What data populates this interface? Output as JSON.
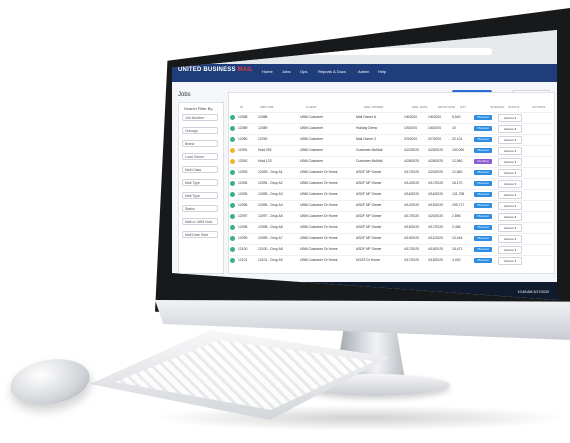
{
  "screen": {
    "brand": {
      "white": "UNITED BUSINESS",
      "red": "MAIL"
    },
    "nav": [
      "Home",
      "Jobs",
      "Ops",
      "Reports & Docs",
      "Admin",
      "Help"
    ],
    "page_title": "Jobs",
    "buttons": {
      "schedule": "+ Schedule Job",
      "export": "Export Data"
    },
    "filters": {
      "title": "Search Filter By",
      "fields": [
        "Job Number",
        "Chicago",
        "Brand",
        "Load Owner",
        "Mail Class",
        "Mail Type",
        "Mail Type",
        "Status",
        "Mail or UBM Now",
        "Mail Date Start"
      ]
    },
    "table_headers": [
      "ID",
      "UBM JOB",
      "CLIENT",
      "MAIL OWNER",
      "MAIL DATE",
      "DROP DATE",
      "QTY",
      "INTERVAL",
      "STATUS",
      "ACTIONS"
    ],
    "rows": [
      {
        "id": "12088",
        "job": "12088",
        "client": "UBM Customer",
        "owner": "Mail Owner A",
        "mail": "1/6/2020",
        "drop": "1/6/2020",
        "qty": "5,540",
        "status": "Planned",
        "color": "#2d8de3"
      },
      {
        "id": "12089",
        "job": "12089",
        "client": "UBM Customer",
        "owner": "Holiday Demo",
        "mail": "1/5/2020",
        "drop": "1/8/2020",
        "qty": "10",
        "status": "Planned",
        "color": "#2d8de3"
      },
      {
        "id": "12090",
        "job": "12290",
        "client": "UBM Customer",
        "owner": "Mail Owner 2",
        "mail": "2/3/2020",
        "drop": "3/7/2020",
        "qty": "22,101",
        "status": "Planned",
        "color": "#2d8de3"
      },
      {
        "id": "12091",
        "job": "Hold 092",
        "client": "UBM Customer",
        "owner": "Customer McMail",
        "mail": "4/22/2020",
        "drop": "4/25/2020",
        "qty": "100,000",
        "status": "Planned",
        "color": "#2d8de3"
      },
      {
        "id": "12092",
        "job": "Hold 123",
        "client": "UBM Customer",
        "owner": "Customer McMail",
        "mail": "4/28/2020",
        "drop": "4/28/2020",
        "qty": "12,560",
        "status": "Pending",
        "color": "#8e5bd6"
      },
      {
        "id": "12093",
        "job": "12093 - Drop A1",
        "client": "UBM Customer Dr Home",
        "owner": "ASDF NP Owner",
        "mail": "4/17/2020",
        "drop": "4/20/2020",
        "qty": "12,840",
        "status": "Planned",
        "color": "#2d8de3"
      },
      {
        "id": "12094",
        "job": "12094 - Drop A2",
        "client": "UBM Customer Dr Home",
        "owner": "ASDF NP Owner",
        "mail": "4/14/2020",
        "drop": "4/17/2020",
        "qty": "18,170",
        "status": "Planned",
        "color": "#2d8de3"
      },
      {
        "id": "12095",
        "job": "12095 - Drop A3",
        "client": "UBM Customer Dr Home",
        "owner": "ASDF NP Owner",
        "mail": "4/16/2020",
        "drop": "4/16/2020",
        "qty": "131,758",
        "status": "Planned",
        "color": "#2d8de3"
      },
      {
        "id": "12096",
        "job": "12096 - Drop A4",
        "client": "UBM Customer Dr Home",
        "owner": "ASDF NP Owner",
        "mail": "4/14/2020",
        "drop": "4/15/2020",
        "qty": "199,717",
        "status": "Planned",
        "color": "#2d8de3"
      },
      {
        "id": "12097",
        "job": "12097 - Drop A5",
        "client": "UBM Customer Dr Home",
        "owner": "ASDF NP Owner",
        "mail": "4/17/2020",
        "drop": "4/20/2020",
        "qty": "2,896",
        "status": "Planned",
        "color": "#2d8de3"
      },
      {
        "id": "12098",
        "job": "12098 - Drop A6",
        "client": "UBM Customer Dr Home",
        "owner": "ASDF NP Owner",
        "mail": "4/15/2020",
        "drop": "4/17/2020",
        "qty": "2,456",
        "status": "Planned",
        "color": "#2d8de3"
      },
      {
        "id": "12099",
        "job": "12099 - Drop A7",
        "client": "UBM Customer Dr Home",
        "owner": "ASDF NP Owner",
        "mail": "4/19/2020",
        "drop": "4/11/2020",
        "qty": "10,444",
        "status": "Planned",
        "color": "#2d8de3"
      },
      {
        "id": "12100",
        "job": "12100 - Drop A8",
        "client": "UBM Customer Dr Home",
        "owner": "ASDF NP Owner",
        "mail": "4/17/2020",
        "drop": "4/18/2020",
        "qty": "18,471",
        "status": "Planned",
        "color": "#2d8de3"
      },
      {
        "id": "12101",
        "job": "12101 - Drop A9",
        "client": "UBM Customer Dr Home",
        "owner": "NOZS Dr Home",
        "mail": "4/17/2020",
        "drop": "4/18/2020",
        "qty": "4,000",
        "status": "Planned",
        "color": "#2d8de3"
      }
    ],
    "action_label": "Actions ▾",
    "clock": {
      "time": "10:48 AM",
      "date": "3/17/2020"
    }
  },
  "colors": {
    "header": "#1f3d7a",
    "accent_red": "#e13b3b",
    "primary": "#2d6bd6",
    "taskbar": "#101c2e"
  }
}
